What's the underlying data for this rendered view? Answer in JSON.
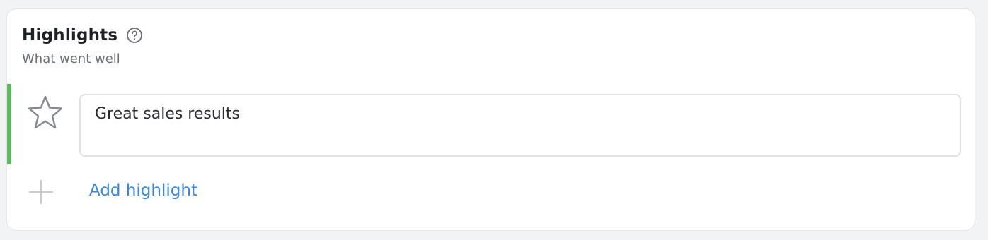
{
  "section": {
    "title": "Highlights",
    "subtitle": "What went well",
    "help_icon": "question-circle-icon"
  },
  "highlights": [
    {
      "icon": "star-outline-icon",
      "text": "Great sales results",
      "accent_color": "#5cb85c"
    }
  ],
  "add_action": {
    "icon": "plus-icon",
    "label": "Add highlight",
    "color": "#3b86dd"
  }
}
